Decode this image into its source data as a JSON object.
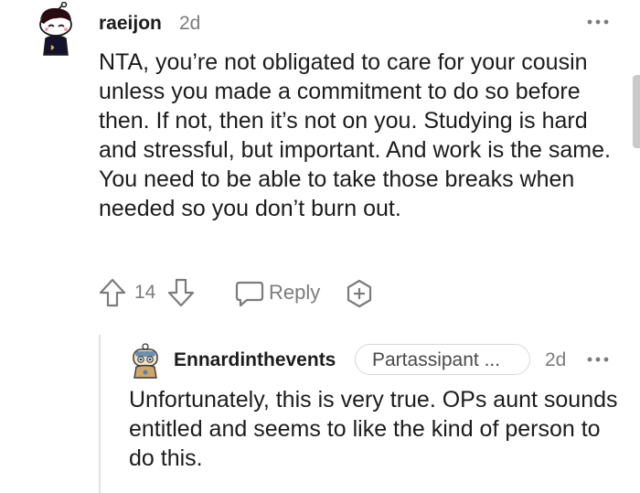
{
  "comment": {
    "username": "raeijon",
    "time": "2d",
    "body": "NTA, you’re not obligated to care for your cousin unless you made a commitment to do so before then. If not, then it’s not on you. Studying is hard and stressful, but important. And work is the same. You need to be able to take those breaks when needed so you don’t burn out.",
    "score": "14",
    "reply_label": "Reply",
    "icons": {
      "avatar": "snoo-avatar",
      "more": "more-options-icon",
      "upvote": "upvote-arrow-icon",
      "downvote": "downvote-arrow-icon",
      "reply": "speech-bubble-icon",
      "award": "award-icon"
    }
  },
  "reply": {
    "username": "Ennardinthevents",
    "flair": "Partassipant ...",
    "time": "2d",
    "body": "Unfortunately, this is very true. OPs aunt sounds entitled and seems to like the kind of person to do this."
  },
  "colors": {
    "text": "#1c1c1c",
    "meta": "#7c7c7c",
    "thread_line": "#e1e1e1",
    "flair_border": "#d8d8d8"
  }
}
